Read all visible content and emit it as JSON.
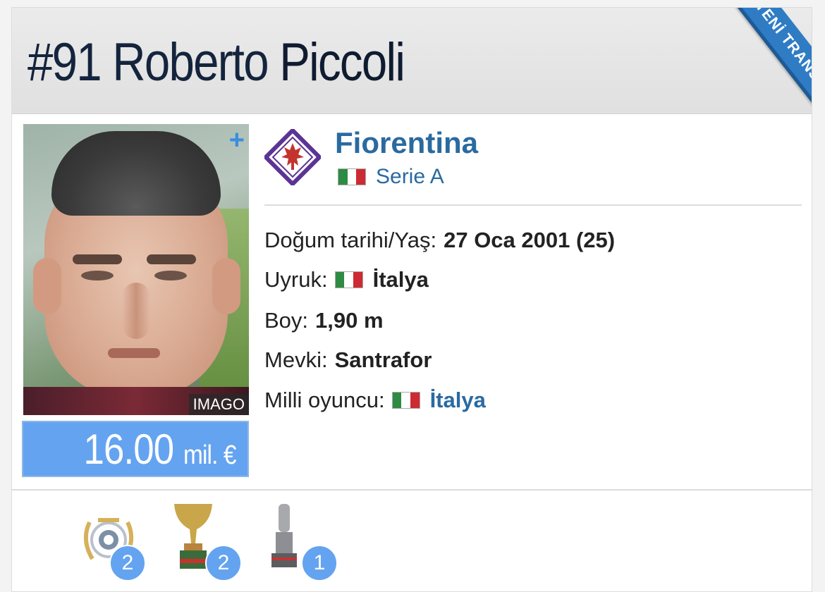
{
  "header": {
    "shirt_number": "#91",
    "first_name": "Roberto",
    "last_name": "Piccoli",
    "ribbon": "YENİ TRANSFER"
  },
  "photo": {
    "credit": "IMAGO",
    "plus": "+"
  },
  "market_value": {
    "amount": "16.00",
    "unit": "mil. €"
  },
  "club": {
    "name": "Fiorentina",
    "league": "Serie A",
    "logo_icon": "fiorentina-crest-icon",
    "logo_color": "#5b3494"
  },
  "info": {
    "birth_label": "Doğum tarihi/Yaş:",
    "birth_value": "27 Oca 2001 (25)",
    "nationality_label": "Uyruk:",
    "nationality_value": "İtalya",
    "height_label": "Boy:",
    "height_value": "1,90 m",
    "position_label": "Mevki:",
    "position_value": "Santrafor",
    "national_label": "Milli oyuncu:",
    "national_value": "İtalya"
  },
  "flag_colors": [
    "#2e8b44",
    "#ffffff",
    "#cc2b33"
  ],
  "accent_color": "#64a3f0",
  "trophies": [
    {
      "icon": "laurel-award-icon",
      "count": "2"
    },
    {
      "icon": "cup-trophy-icon",
      "count": "2"
    },
    {
      "icon": "tall-trophy-icon",
      "count": "1"
    }
  ]
}
